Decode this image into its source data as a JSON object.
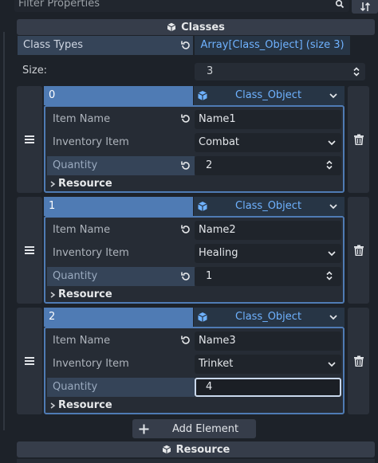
{
  "filter": {
    "placeholder": "Filter Properties"
  },
  "classes_header": {
    "title": "Classes"
  },
  "class_types": {
    "label": "Class Types",
    "value": "Array[Class_Object] (size 3)"
  },
  "size": {
    "label": "Size:",
    "value": "3"
  },
  "elements": [
    {
      "index": "0",
      "type": "Class_Object",
      "item_name_label": "Item Name",
      "item_name_value": "Name1",
      "inventory_label": "Inventory Item",
      "inventory_value": "Combat",
      "quantity_label": "Quantity",
      "quantity_value": "2",
      "resource_label": "Resource"
    },
    {
      "index": "1",
      "type": "Class_Object",
      "item_name_label": "Item Name",
      "item_name_value": "Name2",
      "inventory_label": "Inventory Item",
      "inventory_value": "Healing",
      "quantity_label": "Quantity",
      "quantity_value": "1",
      "resource_label": "Resource"
    },
    {
      "index": "2",
      "type": "Class_Object",
      "item_name_label": "Item Name",
      "item_name_value": "Name3",
      "inventory_label": "Inventory Item",
      "inventory_value": "Trinket",
      "quantity_label": "Quantity",
      "quantity_value": "4",
      "resource_label": "Resource"
    }
  ],
  "add_element": {
    "label": "Add Element"
  },
  "resource_header": {
    "title": "Resource"
  },
  "colors": {
    "background": "#1d2229",
    "accent": "#4f7bb4",
    "link_text": "#6fb2ff",
    "selected_label_bg": "#354458"
  },
  "icons": {
    "search": "search-icon",
    "sort": "sort-icon",
    "class_object": "cube-icon",
    "revert": "revert-icon",
    "drag": "drag-handle-icon",
    "delete": "trash-icon",
    "dropdown": "chevron-down-icon",
    "spinner": "spinner-arrows-icon",
    "expand": "chevron-right-icon",
    "add": "plus-icon"
  }
}
